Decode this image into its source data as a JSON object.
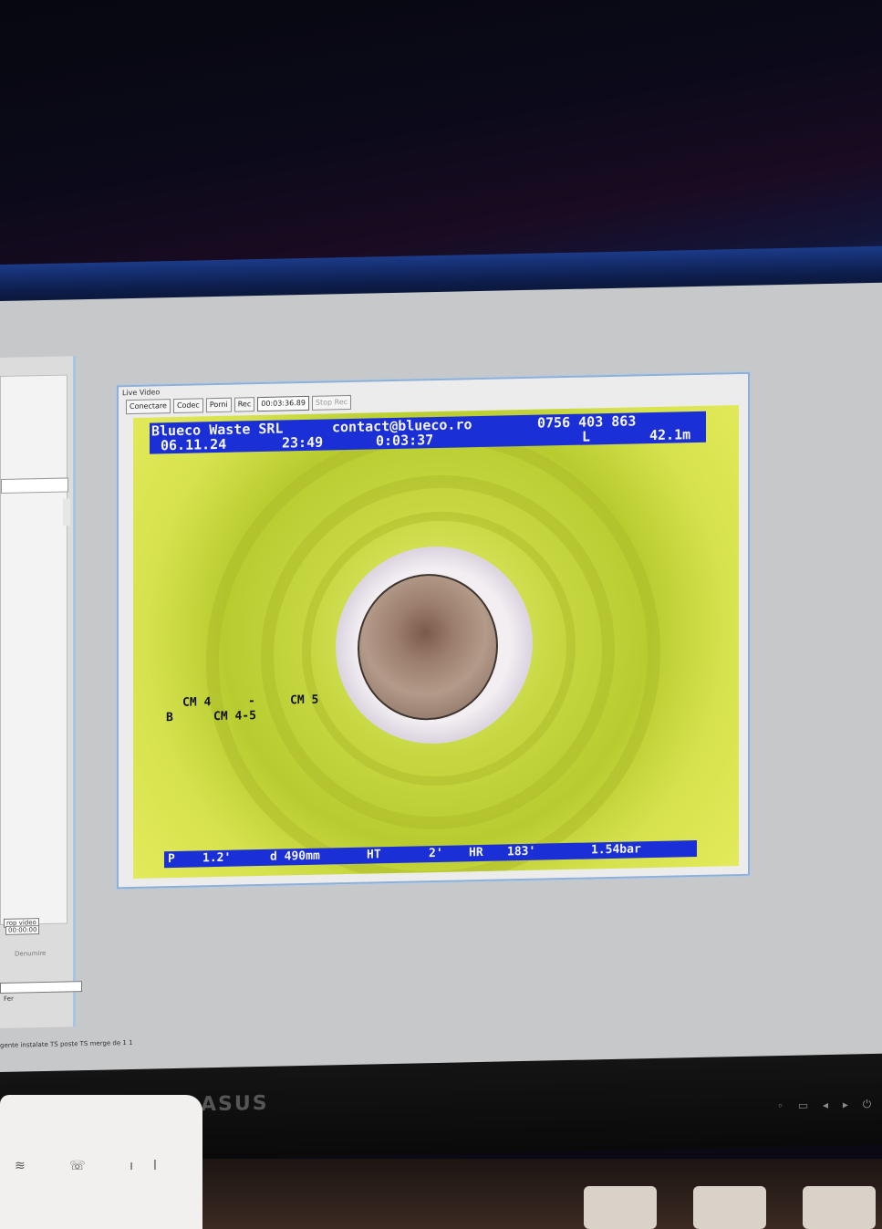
{
  "live_window": {
    "title": "Live Video",
    "toolbar": {
      "buttons": [
        "Conectare",
        "Codec",
        "Porni",
        "Rec"
      ],
      "timer": "00:03:36.89",
      "stop_label": "Stop Rec"
    }
  },
  "osd": {
    "top_line1": {
      "company": "Blueco Waste SRL",
      "email": "contact@blueco.ro",
      "phone": "0756 403 863"
    },
    "top_line2": {
      "date": "06.11.24",
      "time": "23:49",
      "elapsed": "0:03:37",
      "length_label": "L",
      "length": "42.1m"
    },
    "labels": {
      "cm4": "CM 4",
      "dash": "-",
      "cm5": "CM 5",
      "b": "B",
      "cm45": "CM 4-5"
    },
    "bottom": {
      "p": "P",
      "p_val": "1.2'",
      "d": "d 490mm",
      "ht": "HT",
      "ht_val": "2'",
      "hr": "HR",
      "hr_val": "183'",
      "pressure": "1.54bar"
    }
  },
  "left_panel": {
    "stop_video_label": "rop video",
    "stop_video_value": "00:00:00",
    "denumire_label": "Denumire",
    "checkbox_label": "Fer"
  },
  "status_bar": "gente instalate TS poste TS merge de 1 1",
  "monitor": {
    "brand": "ASUS"
  },
  "colors": {
    "osd_blue": "#1a2fd6",
    "video_green": "#c7d742"
  }
}
